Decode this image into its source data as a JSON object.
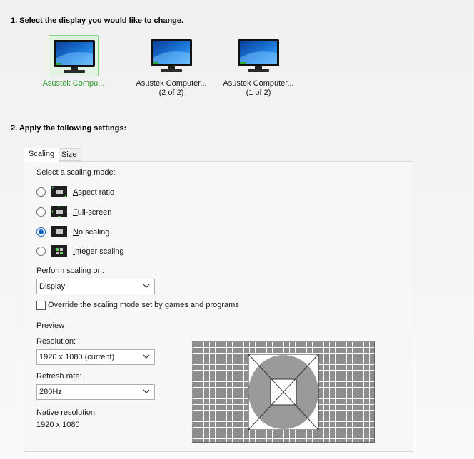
{
  "step1": {
    "heading": "1. Select the display you would like to change."
  },
  "displays": [
    {
      "name": "Asustek Compu...",
      "sub": "",
      "selected": true
    },
    {
      "name": "Asustek Computer...",
      "sub": "(2 of 2)",
      "selected": false
    },
    {
      "name": "Asustek Computer...",
      "sub": "(1 of 2)",
      "selected": false
    }
  ],
  "step2": {
    "heading": "2. Apply the following settings:"
  },
  "tabs": [
    {
      "label": "Scaling",
      "active": true
    },
    {
      "label": "Size",
      "active": false
    }
  ],
  "scaling": {
    "mode_heading": "Select a scaling mode:",
    "modes": [
      {
        "accel": "A",
        "rest": "spect ratio",
        "icon": "aspect-ratio-icon",
        "checked": false
      },
      {
        "accel": "F",
        "rest": "ull-screen",
        "icon": "full-screen-icon",
        "checked": false
      },
      {
        "accel": "N",
        "rest": "o scaling",
        "icon": "no-scaling-icon",
        "checked": true
      },
      {
        "accel": "I",
        "rest": "nteger scaling",
        "icon": "integer-scaling-icon",
        "checked": false
      }
    ],
    "perform_label": "Perform scaling on:",
    "perform_value": "Display",
    "override_label": "Override the scaling mode set by games and programs",
    "override_checked": false
  },
  "preview": {
    "label": "Preview",
    "resolution_label": "Resolution:",
    "resolution_value": "1920 x 1080 (current)",
    "refresh_label": "Refresh rate:",
    "refresh_value": "280Hz",
    "native_label": "Native resolution:",
    "native_value": "1920 x 1080"
  },
  "colors": {
    "accent": "#1565c0",
    "selected_green": "#2e9e2e"
  }
}
